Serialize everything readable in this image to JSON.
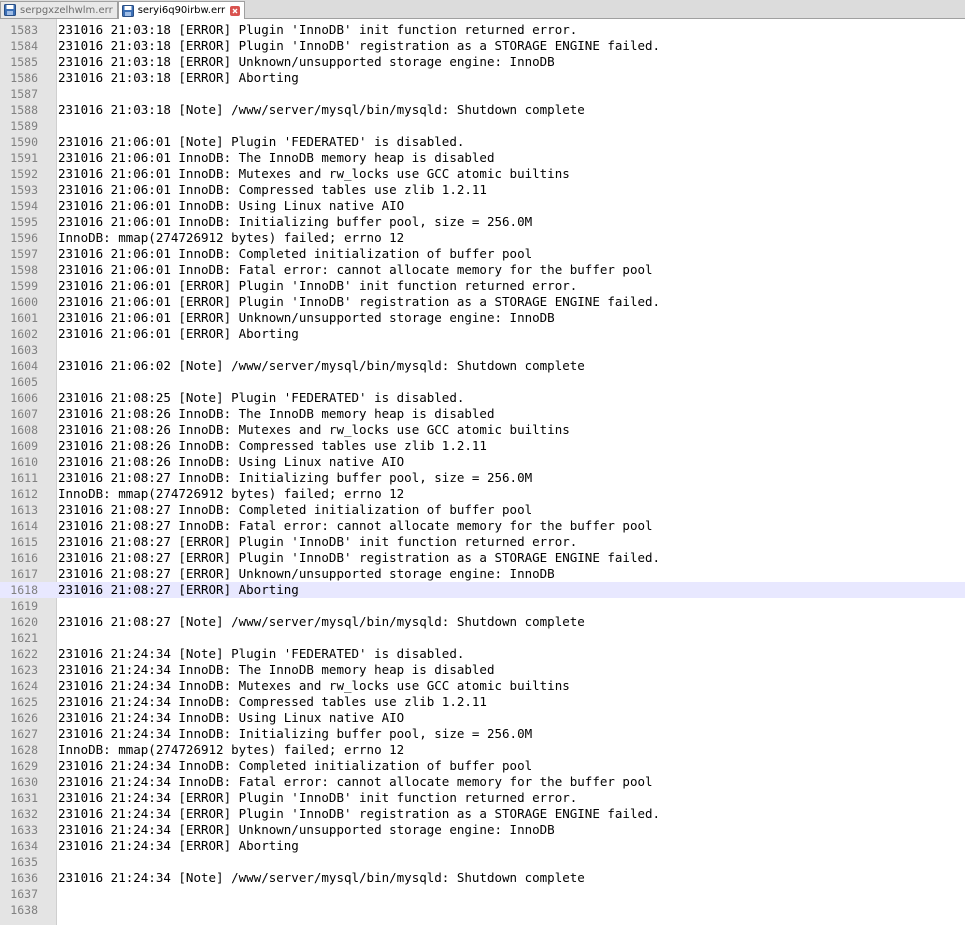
{
  "tabs": [
    {
      "label": "serpgxzelhwlm.err",
      "active": false
    },
    {
      "label": "seryi6q90irbw.err",
      "active": true
    }
  ],
  "editor": {
    "current_line": 1618,
    "lines": [
      {
        "n": "1583",
        "text": "231016 21:03:18 [ERROR] Plugin 'InnoDB' init function returned error."
      },
      {
        "n": "1584",
        "text": "231016 21:03:18 [ERROR] Plugin 'InnoDB' registration as a STORAGE ENGINE failed."
      },
      {
        "n": "1585",
        "text": "231016 21:03:18 [ERROR] Unknown/unsupported storage engine: InnoDB"
      },
      {
        "n": "1586",
        "text": "231016 21:03:18 [ERROR] Aborting"
      },
      {
        "n": "1587",
        "text": ""
      },
      {
        "n": "1588",
        "text": "231016 21:03:18 [Note] /www/server/mysql/bin/mysqld: Shutdown complete"
      },
      {
        "n": "1589",
        "text": ""
      },
      {
        "n": "1590",
        "text": "231016 21:06:01 [Note] Plugin 'FEDERATED' is disabled."
      },
      {
        "n": "1591",
        "text": "231016 21:06:01 InnoDB: The InnoDB memory heap is disabled"
      },
      {
        "n": "1592",
        "text": "231016 21:06:01 InnoDB: Mutexes and rw_locks use GCC atomic builtins"
      },
      {
        "n": "1593",
        "text": "231016 21:06:01 InnoDB: Compressed tables use zlib 1.2.11"
      },
      {
        "n": "1594",
        "text": "231016 21:06:01 InnoDB: Using Linux native AIO"
      },
      {
        "n": "1595",
        "text": "231016 21:06:01 InnoDB: Initializing buffer pool, size = 256.0M"
      },
      {
        "n": "1596",
        "text": "InnoDB: mmap(274726912 bytes) failed; errno 12"
      },
      {
        "n": "1597",
        "text": "231016 21:06:01 InnoDB: Completed initialization of buffer pool"
      },
      {
        "n": "1598",
        "text": "231016 21:06:01 InnoDB: Fatal error: cannot allocate memory for the buffer pool"
      },
      {
        "n": "1599",
        "text": "231016 21:06:01 [ERROR] Plugin 'InnoDB' init function returned error."
      },
      {
        "n": "1600",
        "text": "231016 21:06:01 [ERROR] Plugin 'InnoDB' registration as a STORAGE ENGINE failed."
      },
      {
        "n": "1601",
        "text": "231016 21:06:01 [ERROR] Unknown/unsupported storage engine: InnoDB"
      },
      {
        "n": "1602",
        "text": "231016 21:06:01 [ERROR] Aborting"
      },
      {
        "n": "1603",
        "text": ""
      },
      {
        "n": "1604",
        "text": "231016 21:06:02 [Note] /www/server/mysql/bin/mysqld: Shutdown complete"
      },
      {
        "n": "1605",
        "text": ""
      },
      {
        "n": "1606",
        "text": "231016 21:08:25 [Note] Plugin 'FEDERATED' is disabled."
      },
      {
        "n": "1607",
        "text": "231016 21:08:26 InnoDB: The InnoDB memory heap is disabled"
      },
      {
        "n": "1608",
        "text": "231016 21:08:26 InnoDB: Mutexes and rw_locks use GCC atomic builtins"
      },
      {
        "n": "1609",
        "text": "231016 21:08:26 InnoDB: Compressed tables use zlib 1.2.11"
      },
      {
        "n": "1610",
        "text": "231016 21:08:26 InnoDB: Using Linux native AIO"
      },
      {
        "n": "1611",
        "text": "231016 21:08:27 InnoDB: Initializing buffer pool, size = 256.0M"
      },
      {
        "n": "1612",
        "text": "InnoDB: mmap(274726912 bytes) failed; errno 12"
      },
      {
        "n": "1613",
        "text": "231016 21:08:27 InnoDB: Completed initialization of buffer pool"
      },
      {
        "n": "1614",
        "text": "231016 21:08:27 InnoDB: Fatal error: cannot allocate memory for the buffer pool"
      },
      {
        "n": "1615",
        "text": "231016 21:08:27 [ERROR] Plugin 'InnoDB' init function returned error."
      },
      {
        "n": "1616",
        "text": "231016 21:08:27 [ERROR] Plugin 'InnoDB' registration as a STORAGE ENGINE failed."
      },
      {
        "n": "1617",
        "text": "231016 21:08:27 [ERROR] Unknown/unsupported storage engine: InnoDB"
      },
      {
        "n": "1618",
        "text": "231016 21:08:27 [ERROR] Aborting"
      },
      {
        "n": "1619",
        "text": ""
      },
      {
        "n": "1620",
        "text": "231016 21:08:27 [Note] /www/server/mysql/bin/mysqld: Shutdown complete"
      },
      {
        "n": "1621",
        "text": ""
      },
      {
        "n": "1622",
        "text": "231016 21:24:34 [Note] Plugin 'FEDERATED' is disabled."
      },
      {
        "n": "1623",
        "text": "231016 21:24:34 InnoDB: The InnoDB memory heap is disabled"
      },
      {
        "n": "1624",
        "text": "231016 21:24:34 InnoDB: Mutexes and rw_locks use GCC atomic builtins"
      },
      {
        "n": "1625",
        "text": "231016 21:24:34 InnoDB: Compressed tables use zlib 1.2.11"
      },
      {
        "n": "1626",
        "text": "231016 21:24:34 InnoDB: Using Linux native AIO"
      },
      {
        "n": "1627",
        "text": "231016 21:24:34 InnoDB: Initializing buffer pool, size = 256.0M"
      },
      {
        "n": "1628",
        "text": "InnoDB: mmap(274726912 bytes) failed; errno 12"
      },
      {
        "n": "1629",
        "text": "231016 21:24:34 InnoDB: Completed initialization of buffer pool"
      },
      {
        "n": "1630",
        "text": "231016 21:24:34 InnoDB: Fatal error: cannot allocate memory for the buffer pool"
      },
      {
        "n": "1631",
        "text": "231016 21:24:34 [ERROR] Plugin 'InnoDB' init function returned error."
      },
      {
        "n": "1632",
        "text": "231016 21:24:34 [ERROR] Plugin 'InnoDB' registration as a STORAGE ENGINE failed."
      },
      {
        "n": "1633",
        "text": "231016 21:24:34 [ERROR] Unknown/unsupported storage engine: InnoDB"
      },
      {
        "n": "1634",
        "text": "231016 21:24:34 [ERROR] Aborting"
      },
      {
        "n": "1635",
        "text": ""
      },
      {
        "n": "1636",
        "text": "231016 21:24:34 [Note] /www/server/mysql/bin/mysqld: Shutdown complete"
      },
      {
        "n": "1637",
        "text": ""
      },
      {
        "n": "1638",
        "text": ""
      }
    ]
  }
}
